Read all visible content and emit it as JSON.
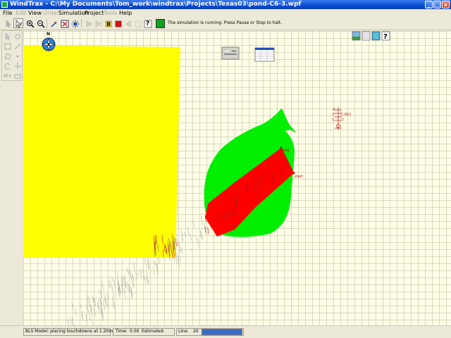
{
  "window": {
    "title": "WindTrax - C:\\My Documents\\Tom_work\\windtrax\\Projects\\Texas03\\pond-C6-3.wpf",
    "minimize": "_",
    "maximize": "□",
    "close": "x"
  },
  "menu": [
    {
      "label": "File",
      "enabled": true
    },
    {
      "label": "Edit",
      "enabled": false
    },
    {
      "label": "View",
      "enabled": true
    },
    {
      "label": "Order",
      "enabled": false
    },
    {
      "label": "Simulation",
      "enabled": true
    },
    {
      "label": "Project",
      "enabled": true
    },
    {
      "label": "Tools",
      "enabled": false
    },
    {
      "label": "Help",
      "enabled": true
    }
  ],
  "toolbar": {
    "status_message": "The simulation is running.  Press Pause or Stop to halt.",
    "status_color": "#0ea21e",
    "help_label": "?"
  },
  "palette": {
    "item1": "M+"
  },
  "map": {
    "compass_label": "N",
    "source_end_label": "end",
    "source_start_label": "start",
    "sensor_labels": [
      "A",
      "P",
      "C(BG)",
      "S",
      "T"
    ],
    "colors": {
      "paddock": "#ffff00",
      "pond": "#00ee00",
      "touchdowns_in_pond": "#ff0000",
      "trajectories": "#a0a0a0",
      "sensor": "#c03030"
    },
    "right_toolbar_help": "?"
  },
  "statusbar": {
    "model_status": "BLS Model: placing touchdowns at 1.20m",
    "time_label": "Time:",
    "time_value": "0.00",
    "estimated_label": "Estimated:",
    "estimated_value": "",
    "line_label": "Line:",
    "line_value": "20",
    "progress": 1.0
  }
}
